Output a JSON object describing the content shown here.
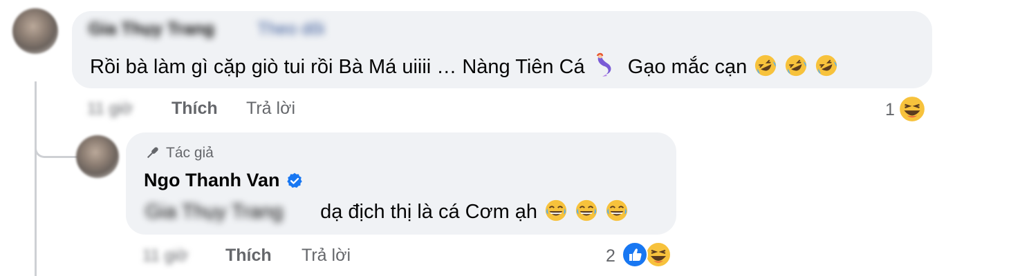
{
  "comment1": {
    "author_blurred": "Gia Thụy Trang",
    "tag_blurred": "Theo dõi",
    "text": "Rồi bà làm gì cặp giò tui rồi Bà Má uiiii … Nàng Tiên Cá",
    "text_tail": "Gạo mắc cạn",
    "time_blurred": "11 giờ",
    "like_label": "Thích",
    "reply_label": "Trả lời",
    "reaction_count": "1"
  },
  "reply1": {
    "badge_label": "Tác giả",
    "author": "Ngo Thanh Van",
    "mention_blurred": "Gia Thụy Trang",
    "text": "dạ địch thị là cá Cơm ạh",
    "time_blurred": "11 giờ",
    "like_label": "Thích",
    "reply_label": "Trả lời",
    "reaction_count": "2"
  },
  "colors": {
    "bubble": "#f0f2f5",
    "secondary_text": "#65676b",
    "verified_blue": "#1877f2",
    "thread_line": "#ced0d4"
  }
}
